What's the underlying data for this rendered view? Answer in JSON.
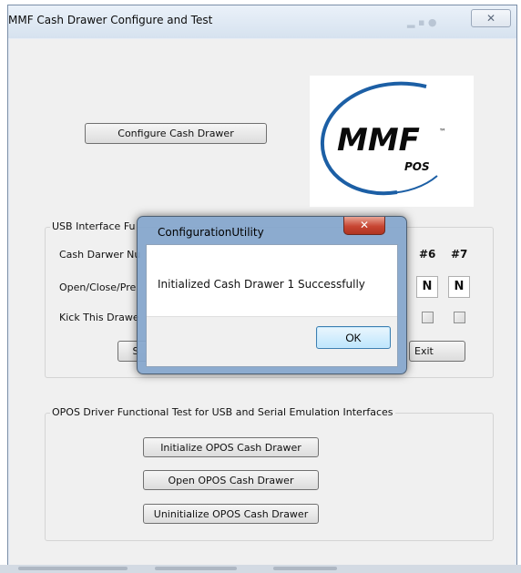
{
  "window": {
    "title": "MMF Cash Drawer Configure and Test",
    "close_glyph": "✕",
    "controls_hint": "▂ ▪ ●"
  },
  "configure_button": "Configure Cash Drawer",
  "logo": {
    "brand": "MMF",
    "sub": "POS",
    "tm": "™"
  },
  "usb_group": {
    "title": "USB Interface Fu",
    "row_labels": [
      "Cash Darwer Nu",
      "Open/Close/Pre",
      "Kick This Drawe"
    ],
    "columns": [
      {
        "header": "#6",
        "value": "N",
        "checked": false
      },
      {
        "header": "#7",
        "value": "N",
        "checked": false
      }
    ],
    "left_button_fragment": "S",
    "exit_button": "Exit"
  },
  "opos_group": {
    "title": "OPOS Driver Functional Test for USB and Serial Emulation Interfaces",
    "buttons": [
      "Initialize OPOS Cash Drawer",
      "Open OPOS Cash Drawer",
      "Uninitialize OPOS Cash Drawer"
    ]
  },
  "dialog": {
    "title": "ConfigurationUtility",
    "close_glyph": "✕",
    "message": "Initialized Cash Drawer 1 Successfully",
    "ok": "OK"
  },
  "colors": {
    "logo_blue": "#1c5fa5",
    "logo_text": "#0b0b0b",
    "dialog_close_red": "#c74532"
  },
  "icons": [
    "close-icon",
    "mmf-pos-logo"
  ]
}
